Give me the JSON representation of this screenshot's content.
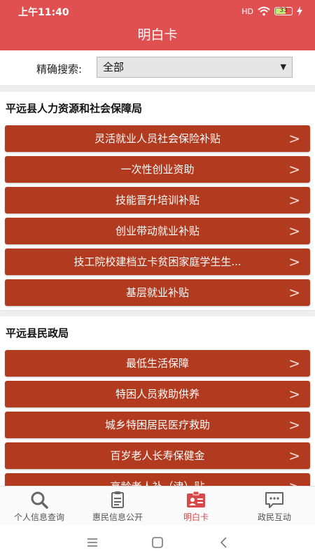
{
  "status": {
    "time": "上午11:40",
    "signal": "HD",
    "battery": "33"
  },
  "app": {
    "title": "明白卡"
  },
  "search": {
    "label": "精确搜索:",
    "selected": "全部"
  },
  "sections": [
    {
      "title": "平远县人力资源和社会保障局",
      "items": [
        "灵活就业人员社会保险补贴",
        "一次性创业资助",
        "技能晋升培训补贴",
        "创业带动就业补贴",
        "技工院校建档立卡贫困家庭学生生...",
        "基层就业补贴"
      ]
    },
    {
      "title": "平远县民政局",
      "items": [
        "最低生活保障",
        "特困人员救助供养",
        "城乡特困居民医疗救助",
        "百岁老人长寿保健金",
        "高龄老人补（津）贴"
      ]
    }
  ],
  "tabs": [
    {
      "label": "个人信息查询",
      "icon": "search-icon"
    },
    {
      "label": "惠民信息公开",
      "icon": "clipboard-icon"
    },
    {
      "label": "明白卡",
      "icon": "id-card-icon",
      "active": true
    },
    {
      "label": "政民互动",
      "icon": "chat-icon"
    }
  ],
  "colors": {
    "accent": "#e05050",
    "item_bg": "#b23a1f",
    "active_tab": "#d84a4a"
  }
}
